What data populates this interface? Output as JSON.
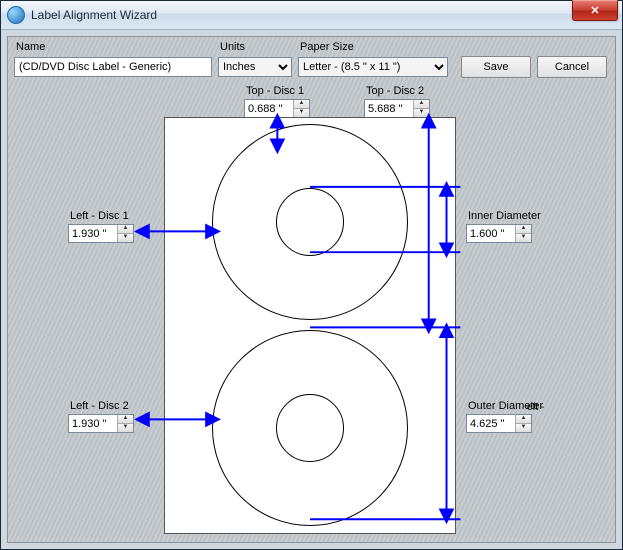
{
  "window": {
    "title": "Label Alignment Wizard",
    "close_glyph": "✕"
  },
  "toolbar": {
    "name_label": "Name",
    "name_value": "(CD/DVD Disc Label - Generic)",
    "units_label": "Units",
    "units_value": "Inches",
    "papersize_label": "Paper Size",
    "papersize_value": "Letter - (8.5 \" x 11 \")",
    "save_label": "Save",
    "cancel_label": "Cancel"
  },
  "measurements": {
    "top_disc1": {
      "label": "Top - Disc 1",
      "value": "0.688 \""
    },
    "top_disc2": {
      "label": "Top - Disc 2",
      "value": "5.688 \""
    },
    "left_disc1": {
      "label": "Left - Disc 1",
      "value": "1.930 \""
    },
    "left_disc2": {
      "label": "Left - Disc 2",
      "value": "1.930 \""
    },
    "inner_diameter": {
      "label": "Inner Diameter",
      "value": "1.600 \""
    },
    "outer_diameter": {
      "label": "Outer Diameter",
      "tail": "eft -",
      "value": "4.625 \""
    }
  },
  "colors": {
    "arrow": "#0000FF"
  }
}
